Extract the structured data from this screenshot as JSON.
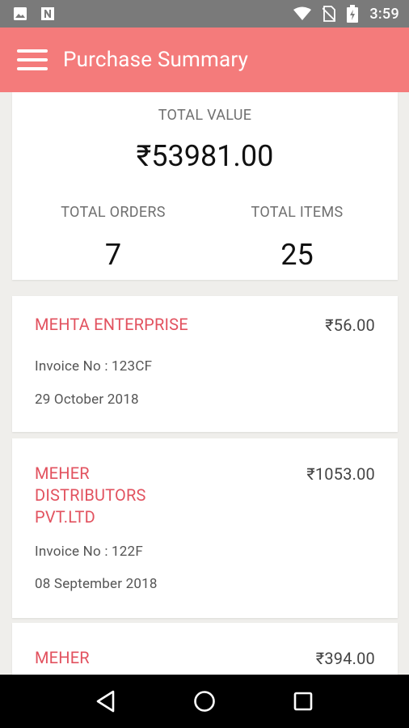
{
  "status_bar": {
    "time": "3:59",
    "left_icons": [
      "image-icon",
      "n-notification-icon"
    ],
    "right_icons": [
      "wifi-icon",
      "no-sim-icon",
      "battery-icon"
    ]
  },
  "app_bar": {
    "title": "Purchase Summary",
    "color": "#f47b7b"
  },
  "summary": {
    "total_value_label": "TOTAL VALUE",
    "total_value": "₹53981.00",
    "total_orders_label": "TOTAL ORDERS",
    "total_orders": "7",
    "total_items_label": "TOTAL ITEMS",
    "total_items": "25"
  },
  "purchases": [
    {
      "vendor_lines": [
        "MEHTA ENTERPRISE"
      ],
      "amount": "₹56.00",
      "invoice": "Invoice No : 123CF",
      "date": "29 October 2018"
    },
    {
      "vendor_lines": [
        "MEHER",
        "DISTRIBUTORS",
        "PVT.LTD"
      ],
      "amount": "₹1053.00",
      "invoice": "Invoice No : 122F",
      "date": "08 September 2018"
    },
    {
      "vendor_lines": [
        "MEHER"
      ],
      "amount": "₹394.00",
      "invoice": "",
      "date": ""
    }
  ],
  "nav": [
    "back-icon",
    "home-icon",
    "recents-icon"
  ]
}
